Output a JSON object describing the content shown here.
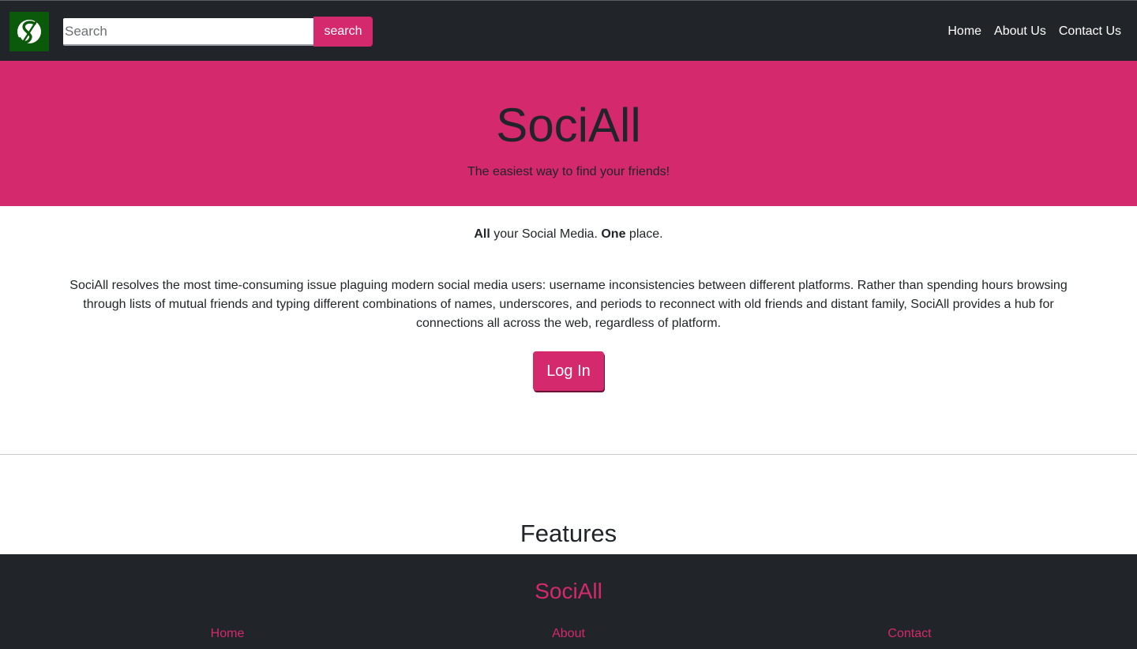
{
  "navbar": {
    "logo_icon": "socialall-s-logo-icon",
    "search": {
      "placeholder": "Search",
      "value": ""
    },
    "search_button_label": "search",
    "links": [
      "Home",
      "About Us",
      "Contact Us"
    ]
  },
  "hero": {
    "title": "SociAll",
    "subtitle": "The easiest way to find your friends!"
  },
  "main": {
    "tagline": {
      "part1_bold": "All",
      "part2": " your Social Media. ",
      "part3_bold": "One",
      "part4": " place."
    },
    "description": "SociAll resolves the most time-consuming issue plaguing modern social media users: username inconsistencies between different platforms. Rather than spending hours browsing through lists of mutual friends and typing different combinations of names, underscores, and periods to reconnect with old friends and distant family, SociAll provides a hub for connections all across the web, regardless of platform.",
    "login_button_label": "Log In",
    "features_heading": "Features"
  },
  "footer": {
    "brand": "SociAll",
    "links": [
      "Home",
      "About",
      "Contact"
    ]
  },
  "colors": {
    "accent": "#d4296d",
    "dark": "#212529",
    "logo_bg": "#0b5a0b"
  }
}
